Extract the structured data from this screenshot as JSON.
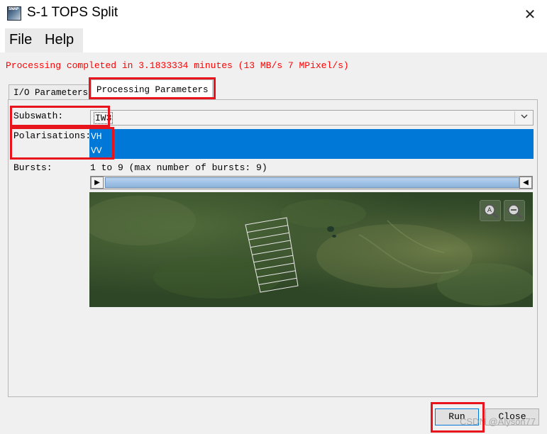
{
  "window": {
    "title": "S-1 TOPS Split",
    "close_glyph": "✕",
    "icon": "snap-app-icon",
    "icon_text": "SNAP"
  },
  "menu": {
    "items": [
      "File",
      "Help"
    ]
  },
  "status": {
    "message": "Processing completed in 3.1833334 minutes (13 MB/s 7 MPixel/s)",
    "color": "#ff0000"
  },
  "tabs": [
    {
      "label": "I/O Parameters",
      "selected": false
    },
    {
      "label": "Processing Parameters",
      "selected": true
    }
  ],
  "params": {
    "subswath_label": "Subswath:",
    "subswath_value": "IW3",
    "polarisations_label": "Polarisations:",
    "polarisations": [
      "VH",
      "VV"
    ],
    "bursts_label": "Bursts:",
    "bursts_text": "1 to 9 (max number of bursts: 9)",
    "burst_range": {
      "first": 1,
      "last": 9,
      "max": 9
    }
  },
  "map": {
    "zoom_in_icon": "zoom-in-icon",
    "zoom_out_icon": "zoom-out-icon",
    "burst_count": 9
  },
  "buttons": {
    "run": "Run",
    "close": "Close"
  },
  "watermark": "CSDN @Alyson77",
  "colors": {
    "selection": "#0078d7",
    "highlight": "#e8141c"
  }
}
